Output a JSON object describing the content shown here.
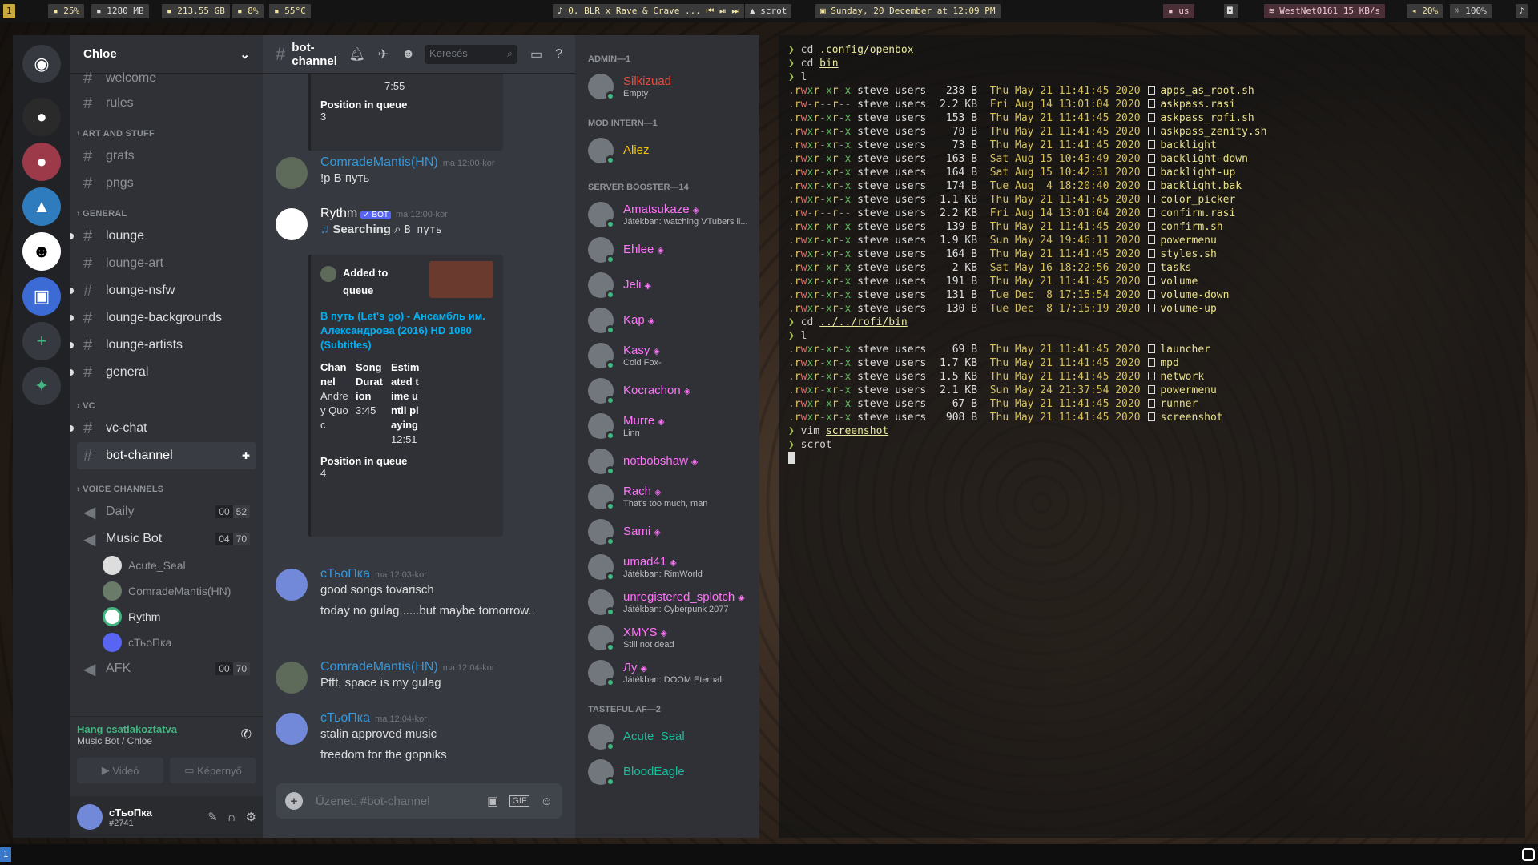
{
  "topbar": {
    "workspace": "1",
    "cpu": "25%",
    "ram": "1280 MB",
    "disk": "213.55 GB",
    "battery": "8%",
    "temp": "55°C",
    "music": "0. BLR x Rave & Crave ...",
    "window": "scrot",
    "datetime": "Sunday, 20 December at 12:09 PM",
    "keyboard": "us",
    "wifi": "WestNet0161",
    "net_speed": "15 KB/s",
    "volume": "20%",
    "brightness": "100%"
  },
  "discord": {
    "server_name": "Chloe",
    "channels_top": [
      {
        "name": "welcome"
      },
      {
        "name": "rules"
      }
    ],
    "categories": [
      {
        "name": "ART AND STUFF",
        "channels": [
          "grafs",
          "pngs"
        ]
      },
      {
        "name": "GENERAL",
        "channels": [
          "lounge",
          "lounge-art",
          "lounge-nsfw",
          "lounge-backgrounds",
          "lounge-artists",
          "general"
        ]
      },
      {
        "name": "VC",
        "channels": [
          "vc-chat",
          "bot-channel"
        ]
      },
      {
        "name": "VOICE CHANNELS"
      }
    ],
    "voice_channels": [
      {
        "name": "Daily",
        "a": "00",
        "b": "52"
      },
      {
        "name": "Music Bot",
        "a": "04",
        "b": "70"
      },
      {
        "name": "AFK",
        "a": "00",
        "b": "70"
      }
    ],
    "voice_users": [
      "Acute_Seal",
      "ComradeMantis(HN)",
      "Rythm",
      "сТьоПка"
    ],
    "voice_status": "Hang csatlakoztatva",
    "voice_location": "Music Bot / Chloe",
    "video_label": "Videó",
    "screen_label": "Képernyő",
    "user": {
      "name": "сТьоПка",
      "tag": "#2741"
    },
    "channel_title": "bot-channel",
    "search_placeholder": "Keresés",
    "input_placeholder": "Üzenet: #bot-channel",
    "messages": {
      "embed1_time": "7:55",
      "embed1_pos_label": "Position in queue",
      "embed1_pos": "3",
      "m1_user": "ComradeMantis(HN)",
      "m1_time": "ma 12:00-kor",
      "m1_text": "!p В путь",
      "m2_user": "Rythm",
      "m2_bot": "BOT",
      "m2_time": "ma 12:00-kor",
      "m2_search": "Searching",
      "m2_query": "В путь",
      "embed2_added": "Added to queue",
      "embed2_title": "В путь (Let's go) - Ансамбль им. Александрова (2016) HD 1080 (Subtitles)",
      "embed2_ch_label": "Channel",
      "embed2_ch": "Andrey Quoc",
      "embed2_dur_label": "Song Duration",
      "embed2_dur": "3:45",
      "embed2_est_label": "Estimated time until playing",
      "embed2_est": "12:51",
      "embed2_pos_label": "Position in queue",
      "embed2_pos": "4",
      "m3_user": "сТьоПка",
      "m3_time": "ma 12:03-kor",
      "m3_text1": "good songs tovarisch",
      "m3_text2": "today no gulag......but maybe tomorrow..",
      "m4_user": "ComradeMantis(HN)",
      "m4_time": "ma 12:04-kor",
      "m4_text": "Pfft, space is my gulag",
      "m5_user": "сТьоПка",
      "m5_time": "ma 12:04-kor",
      "m5_text1": "stalin approved music",
      "m5_text2": "freedom for the gopniks"
    },
    "member_groups": [
      {
        "title": "ADMIN—1",
        "members": [
          {
            "name": "Silkizuad",
            "sub": "Empty",
            "color": "#e74c3c"
          }
        ]
      },
      {
        "title": "MOD INTERN—1",
        "members": [
          {
            "name": "Aliez",
            "sub": "",
            "color": "#f1c40f"
          }
        ]
      },
      {
        "title": "SERVER BOOSTER—14",
        "members": [
          {
            "name": "Amatsukaze",
            "sub": "Játékban: watching VTubers li...",
            "color": "#ff73fa"
          },
          {
            "name": "Ehlee",
            "sub": "",
            "color": "#ff73fa"
          },
          {
            "name": "Jeli",
            "sub": "",
            "color": "#ff73fa"
          },
          {
            "name": "Kap",
            "sub": "",
            "color": "#ff73fa"
          },
          {
            "name": "Kasy",
            "sub": "Cold Fox-",
            "color": "#ff73fa"
          },
          {
            "name": "Kocrachon",
            "sub": "",
            "color": "#ff73fa"
          },
          {
            "name": "Murre",
            "sub": "Linn",
            "color": "#ff73fa"
          },
          {
            "name": "notbobshaw",
            "sub": "",
            "color": "#ff73fa"
          },
          {
            "name": "Rach",
            "sub": "That's too much, man",
            "color": "#ff73fa"
          },
          {
            "name": "Sami",
            "sub": "",
            "color": "#ff73fa"
          },
          {
            "name": "umad41",
            "sub": "Játékban: RimWorld",
            "color": "#ff73fa"
          },
          {
            "name": "unregistered_splotch",
            "sub": "Játékban: Cyberpunk 2077",
            "color": "#ff73fa"
          },
          {
            "name": "XMYS",
            "sub": "Still not dead",
            "color": "#ff73fa"
          },
          {
            "name": "Лу",
            "sub": "Játékban: DOOM Eternal",
            "color": "#ff73fa"
          }
        ]
      },
      {
        "title": "TASTEFUL AF—2",
        "members": [
          {
            "name": "Acute_Seal",
            "sub": "",
            "color": "#1abc9c"
          },
          {
            "name": "BloodEagle",
            "sub": "",
            "color": "#1abc9c"
          }
        ]
      }
    ]
  },
  "terminal": {
    "cmd1": "cd",
    "arg1": ".config/openbox",
    "cmd2": "cd",
    "arg2": "bin",
    "cmd3": "l",
    "files1": [
      {
        "perm": ".rwxr-xr-x",
        "owner": "steve users",
        "size": "238 B",
        "date": "Thu May 21 11:41:45 2020",
        "name": "apps_as_root.sh"
      },
      {
        "perm": ".rw-r--r--",
        "owner": "steve users",
        "size": "2.2 KB",
        "date": "Fri Aug 14 13:01:04 2020",
        "name": "askpass.rasi"
      },
      {
        "perm": ".rwxr-xr-x",
        "owner": "steve users",
        "size": "153 B",
        "date": "Thu May 21 11:41:45 2020",
        "name": "askpass_rofi.sh"
      },
      {
        "perm": ".rwxr-xr-x",
        "owner": "steve users",
        "size": "70 B",
        "date": "Thu May 21 11:41:45 2020",
        "name": "askpass_zenity.sh"
      },
      {
        "perm": ".rwxr-xr-x",
        "owner": "steve users",
        "size": "73 B",
        "date": "Thu May 21 11:41:45 2020",
        "name": "backlight"
      },
      {
        "perm": ".rwxr-xr-x",
        "owner": "steve users",
        "size": "163 B",
        "date": "Sat Aug 15 10:43:49 2020",
        "name": "backlight-down"
      },
      {
        "perm": ".rwxr-xr-x",
        "owner": "steve users",
        "size": "164 B",
        "date": "Sat Aug 15 10:42:31 2020",
        "name": "backlight-up"
      },
      {
        "perm": ".rwxr-xr-x",
        "owner": "steve users",
        "size": "174 B",
        "date": "Tue Aug  4 18:20:40 2020",
        "name": "backlight.bak"
      },
      {
        "perm": ".rwxr-xr-x",
        "owner": "steve users",
        "size": "1.1 KB",
        "date": "Thu May 21 11:41:45 2020",
        "name": "color_picker"
      },
      {
        "perm": ".rw-r--r--",
        "owner": "steve users",
        "size": "2.2 KB",
        "date": "Fri Aug 14 13:01:04 2020",
        "name": "confirm.rasi"
      },
      {
        "perm": ".rwxr-xr-x",
        "owner": "steve users",
        "size": "139 B",
        "date": "Thu May 21 11:41:45 2020",
        "name": "confirm.sh"
      },
      {
        "perm": ".rwxr-xr-x",
        "owner": "steve users",
        "size": "1.9 KB",
        "date": "Sun May 24 19:46:11 2020",
        "name": "powermenu"
      },
      {
        "perm": ".rwxr-xr-x",
        "owner": "steve users",
        "size": "164 B",
        "date": "Thu May 21 11:41:45 2020",
        "name": "styles.sh"
      },
      {
        "perm": ".rwxr-xr-x",
        "owner": "steve users",
        "size": "2 KB",
        "date": "Sat May 16 18:22:56 2020",
        "name": "tasks"
      },
      {
        "perm": ".rwxr-xr-x",
        "owner": "steve users",
        "size": "191 B",
        "date": "Thu May 21 11:41:45 2020",
        "name": "volume"
      },
      {
        "perm": ".rwxr-xr-x",
        "owner": "steve users",
        "size": "131 B",
        "date": "Tue Dec  8 17:15:54 2020",
        "name": "volume-down"
      },
      {
        "perm": ".rwxr-xr-x",
        "owner": "steve users",
        "size": "130 B",
        "date": "Tue Dec  8 17:15:19 2020",
        "name": "volume-up"
      }
    ],
    "cmd4": "cd",
    "arg4": "../../rofi/bin",
    "cmd5": "l",
    "files2": [
      {
        "perm": ".rwxr-xr-x",
        "owner": "steve users",
        "size": "69 B",
        "date": "Thu May 21 11:41:45 2020",
        "name": "launcher"
      },
      {
        "perm": ".rwxr-xr-x",
        "owner": "steve users",
        "size": "1.7 KB",
        "date": "Thu May 21 11:41:45 2020",
        "name": "mpd"
      },
      {
        "perm": ".rwxr-xr-x",
        "owner": "steve users",
        "size": "1.5 KB",
        "date": "Thu May 21 11:41:45 2020",
        "name": "network"
      },
      {
        "perm": ".rwxr-xr-x",
        "owner": "steve users",
        "size": "2.1 KB",
        "date": "Sun May 24 21:37:54 2020",
        "name": "powermenu"
      },
      {
        "perm": ".rwxr-xr-x",
        "owner": "steve users",
        "size": "67 B",
        "date": "Thu May 21 11:41:45 2020",
        "name": "runner"
      },
      {
        "perm": ".rwxr-xr-x",
        "owner": "steve users",
        "size": "908 B",
        "date": "Thu May 21 11:41:45 2020",
        "name": "screenshot"
      }
    ],
    "cmd6": "vim",
    "arg6": "screenshot",
    "cmd7": "scrot"
  }
}
